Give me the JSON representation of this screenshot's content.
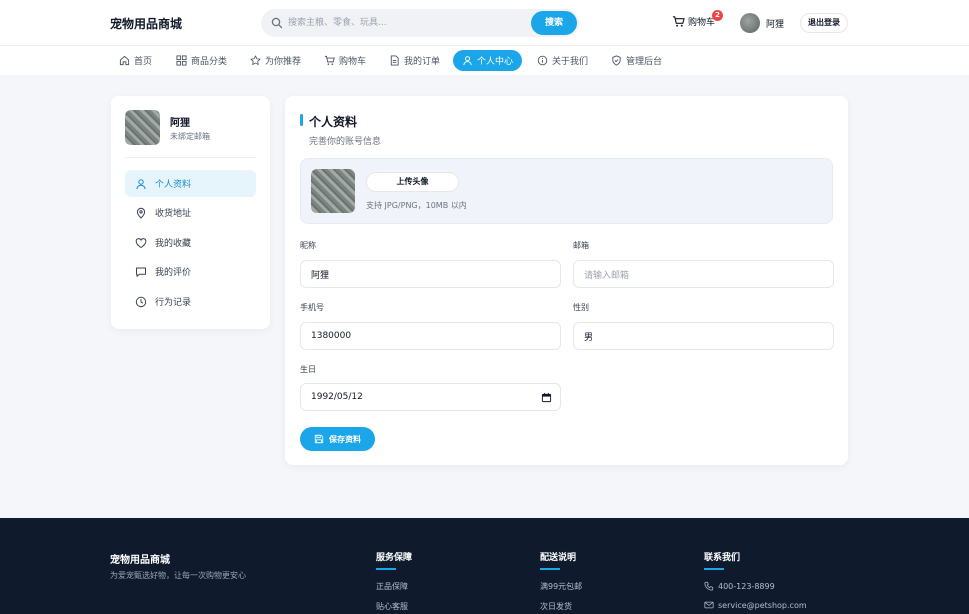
{
  "header": {
    "brand": "宠物用品商城",
    "search_placeholder": "搜索主粮、零食、玩具...",
    "search_button": "搜索",
    "cart_label": "购物车",
    "cart_count": "2",
    "user_name": "阿狸",
    "logout": "退出登录"
  },
  "nav": {
    "items": [
      {
        "label": "首页",
        "icon": "home-icon"
      },
      {
        "label": "商品分类",
        "icon": "grid-icon"
      },
      {
        "label": "为你推荐",
        "icon": "star-icon"
      },
      {
        "label": "购物车",
        "icon": "cart-icon"
      },
      {
        "label": "我的订单",
        "icon": "document-icon"
      },
      {
        "label": "个人中心",
        "icon": "user-icon",
        "active": true
      },
      {
        "label": "关于我们",
        "icon": "info-icon"
      },
      {
        "label": "管理后台",
        "icon": "shield-icon"
      }
    ]
  },
  "sidebar": {
    "name": "阿狸",
    "email_status": "未绑定邮箱",
    "items": [
      {
        "label": "个人资料",
        "icon": "user-icon",
        "active": true
      },
      {
        "label": "收货地址",
        "icon": "location-icon"
      },
      {
        "label": "我的收藏",
        "icon": "heart-icon"
      },
      {
        "label": "我的评价",
        "icon": "comment-icon"
      },
      {
        "label": "行为记录",
        "icon": "clock-icon"
      }
    ]
  },
  "profile": {
    "title": "个人资料",
    "subtitle": "完善你的账号信息",
    "upload_button": "上传头像",
    "upload_hint": "支持 JPG/PNG，10MB 以内",
    "nickname_label": "昵称",
    "nickname_value": "阿狸",
    "email_label": "邮箱",
    "email_placeholder": "请输入邮箱",
    "phone_label": "手机号",
    "phone_value": "1380000",
    "gender_label": "性别",
    "gender_value": "男",
    "birthday_label": "生日",
    "birthday_value": "1992/05/12",
    "save_button": "保存资料"
  },
  "footer": {
    "brand": "宠物用品商城",
    "slogan": "为爱宠甄选好物，让每一次购物更安心",
    "columns": [
      {
        "heading": "服务保障",
        "items": [
          "正品保障",
          "贴心客服"
        ]
      },
      {
        "heading": "配送说明",
        "items": [
          "满99元包邮",
          "次日发货"
        ]
      },
      {
        "heading": "联系我们",
        "items": [
          "400-123-8899",
          "service@petshop.com"
        ]
      }
    ]
  },
  "colors": {
    "accent": "#1aa6e8",
    "badge": "#ef4444",
    "footer_bg": "#0f1b2d"
  }
}
